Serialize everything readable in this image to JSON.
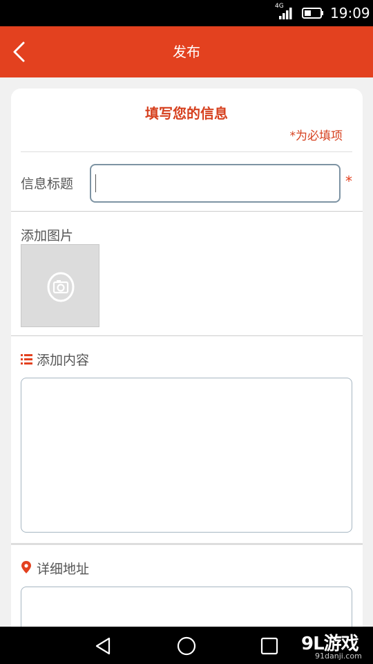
{
  "status_bar": {
    "network": "4G",
    "time": "19:09"
  },
  "app_bar": {
    "title": "发布",
    "back_icon": "chevron-left-icon"
  },
  "form": {
    "heading": "填写您的信息",
    "required_note": "*为必填项",
    "title_field": {
      "label": "信息标题",
      "value": "",
      "placeholder": "",
      "required_mark": "*"
    },
    "image_field": {
      "label": "添加图片",
      "icon": "camera-icon"
    },
    "content_field": {
      "label": "添加内容",
      "icon": "list-icon",
      "value": ""
    },
    "address_field": {
      "label": "详细地址",
      "icon": "location-pin-icon",
      "value": ""
    }
  },
  "nav_bar": {
    "icons": [
      "back-triangle-icon",
      "home-circle-icon",
      "recents-square-icon"
    ]
  },
  "watermark": {
    "logo": "9L游戏",
    "site": "91danji.com"
  },
  "colors": {
    "accent": "#e3411f",
    "heading": "#d6401e",
    "field_border": "#7d93a3"
  }
}
